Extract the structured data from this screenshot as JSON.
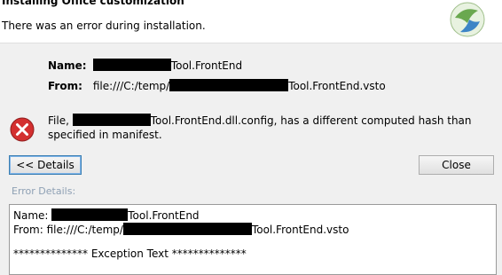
{
  "header": {
    "title": "Installing Office customization",
    "subtitle": "There was an error during installation."
  },
  "info": {
    "name_label": "Name:",
    "name_value_suffix": "Tool.FrontEnd",
    "from_label": "From:",
    "from_value_prefix": "file:///C:/temp/",
    "from_value_suffix": "Tool.FrontEnd.vsto"
  },
  "error": {
    "message_prefix": "File, ",
    "message_suffix": "Tool.FrontEnd.dll.config, has a different computed hash than specified in manifest."
  },
  "buttons": {
    "details_label": "<< Details",
    "close_label": "Close"
  },
  "details": {
    "label": "Error Details:",
    "name_line_prefix": "Name: ",
    "name_line_suffix": "Tool.FrontEnd",
    "from_line_prefix": "From: file:///C:/temp/",
    "from_line_suffix": "Tool.FrontEnd.vsto",
    "exception_line": "************** Exception Text **************"
  }
}
